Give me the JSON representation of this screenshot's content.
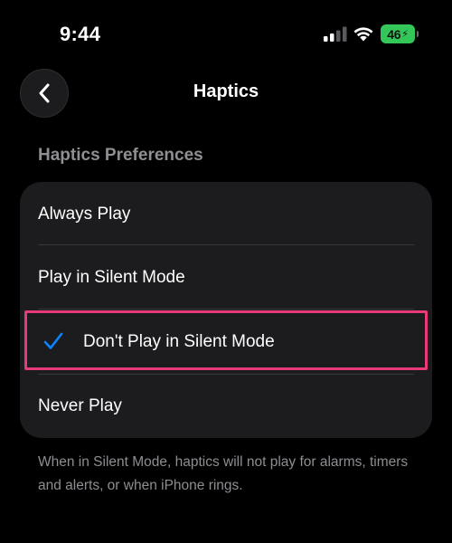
{
  "status_bar": {
    "time": "9:44",
    "battery_level": "46"
  },
  "nav": {
    "title": "Haptics"
  },
  "section": {
    "header": "Haptics Preferences"
  },
  "options": [
    {
      "label": "Always Play",
      "selected": false
    },
    {
      "label": "Play in Silent Mode",
      "selected": false
    },
    {
      "label": "Don't Play in Silent Mode",
      "selected": true
    },
    {
      "label": "Never Play",
      "selected": false
    }
  ],
  "footer_note": "When in Silent Mode, haptics will not play for alarms, timers and alerts, or when iPhone rings.",
  "colors": {
    "background": "#000000",
    "card": "#1c1c1e",
    "accent": "#0a84ff",
    "battery": "#33c759",
    "highlight": "#e8397a",
    "secondary_text": "#8e8e93"
  }
}
